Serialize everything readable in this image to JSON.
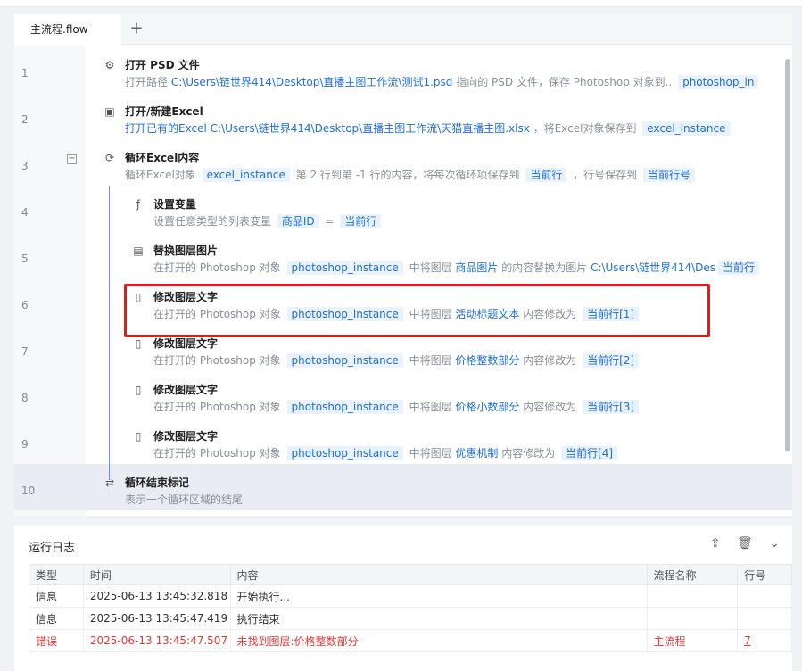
{
  "tab": {
    "label": "主流程.flow",
    "add": "+"
  },
  "steps": [
    {
      "num": "1",
      "icon": "psd",
      "title": "打开 PSD 文件",
      "desc": [
        {
          "t": "text",
          "v": "打开路径 "
        },
        {
          "t": "link",
          "v": "C:\\Users\\链世界414\\Desktop\\直播主图工作流\\测试1.psd"
        },
        {
          "t": "text",
          "v": " 指向的 PSD 文件，保存 Photoshop 对象到.. "
        },
        {
          "t": "chip",
          "v": "photoshop_in"
        }
      ]
    },
    {
      "num": "2",
      "icon": "excel",
      "title": "打开/新建Excel",
      "desc": [
        {
          "t": "link",
          "v": "打开已有的Excel"
        },
        {
          "t": "link",
          "v": "   C:\\Users\\链世界414\\Desktop\\直播主图工作流\\天猫直播主图.xlsx"
        },
        {
          "t": "text",
          "v": " ，将Excel对象保存到 "
        },
        {
          "t": "chip",
          "v": "excel_instance"
        }
      ]
    },
    {
      "num": "3",
      "icon": "loop",
      "title": "循环Excel内容",
      "desc": [
        {
          "t": "text",
          "v": "循环Excel对象 "
        },
        {
          "t": "chip",
          "v": "excel_instance"
        },
        {
          "t": "text",
          "v": " 第 2 行到第 -1 行的内容，将每次循环项保存到 "
        },
        {
          "t": "chip",
          "v": "当前行"
        },
        {
          "t": "text",
          "v": " ，行号保存到 "
        },
        {
          "t": "chip",
          "v": "当前行号"
        }
      ]
    },
    {
      "num": "4",
      "icon": "var",
      "title": "设置变量",
      "desc": [
        {
          "t": "text",
          "v": "设置任意类型的列表变量 "
        },
        {
          "t": "chip",
          "v": "商品ID"
        },
        {
          "t": "text",
          "v": " = "
        },
        {
          "t": "chip",
          "v": "当前行"
        }
      ]
    },
    {
      "num": "5",
      "icon": "img",
      "title": "替换图层图片",
      "desc": [
        {
          "t": "text",
          "v": "在打开的 Photoshop 对象 "
        },
        {
          "t": "chip",
          "v": "photoshop_instance"
        },
        {
          "t": "text",
          "v": " 中将图层 "
        },
        {
          "t": "link",
          "v": "商品图片"
        },
        {
          "t": "text",
          "v": "  的内容替换为图片 "
        },
        {
          "t": "link",
          "v": "C:\\Users\\链世界414\\Des"
        },
        {
          "t": "chip",
          "v": "当前行"
        }
      ]
    },
    {
      "num": "6",
      "icon": "text",
      "title": "修改图层文字",
      "desc": [
        {
          "t": "text",
          "v": "在打开的 Photoshop 对象 "
        },
        {
          "t": "chip",
          "v": "photoshop_instance"
        },
        {
          "t": "text",
          "v": " 中将图层 "
        },
        {
          "t": "link",
          "v": "活动标题文本"
        },
        {
          "t": "text",
          "v": "  内容修改为 "
        },
        {
          "t": "chip",
          "v": "当前行[1]"
        }
      ]
    },
    {
      "num": "7",
      "icon": "text",
      "title": "修改图层文字",
      "desc": [
        {
          "t": "text",
          "v": "在打开的 Photoshop 对象 "
        },
        {
          "t": "chip",
          "v": "photoshop_instance"
        },
        {
          "t": "text",
          "v": " 中将图层 "
        },
        {
          "t": "link",
          "v": "价格整数部分"
        },
        {
          "t": "text",
          "v": "  内容修改为 "
        },
        {
          "t": "chip",
          "v": "当前行[2]"
        }
      ]
    },
    {
      "num": "8",
      "icon": "text",
      "title": "修改图层文字",
      "desc": [
        {
          "t": "text",
          "v": "在打开的 Photoshop 对象 "
        },
        {
          "t": "chip",
          "v": "photoshop_instance"
        },
        {
          "t": "text",
          "v": " 中将图层 "
        },
        {
          "t": "link",
          "v": "价格小数部分"
        },
        {
          "t": "text",
          "v": "  内容修改为 "
        },
        {
          "t": "chip",
          "v": "当前行[3]"
        }
      ]
    },
    {
      "num": "9",
      "icon": "text",
      "title": "修改图层文字",
      "desc": [
        {
          "t": "text",
          "v": "在打开的 Photoshop 对象 "
        },
        {
          "t": "chip",
          "v": "photoshop_instance"
        },
        {
          "t": "text",
          "v": " 中将图层 "
        },
        {
          "t": "link",
          "v": "优惠机制"
        },
        {
          "t": "text",
          "v": "  内容修改为 "
        },
        {
          "t": "chip",
          "v": "当前行[4]"
        }
      ]
    },
    {
      "num": "10",
      "icon": "loopend",
      "title": "循环结束标记",
      "desc": [
        {
          "t": "text",
          "v": "表示一个循环区域的结尾"
        }
      ]
    }
  ],
  "log": {
    "title": "运行日志",
    "columns": [
      "类型",
      "时间",
      "内容",
      "流程名称",
      "行号"
    ],
    "rows": [
      {
        "type": "信息",
        "time": "2025-06-13 13:45:32.818",
        "content": "开始执行...",
        "flow": "",
        "line": ""
      },
      {
        "type": "信息",
        "time": "2025-06-13 13:45:47.419",
        "content": "执行结束",
        "flow": "",
        "line": ""
      },
      {
        "type": "错误",
        "time": "2025-06-13 13:45:47.507",
        "content": "未找到图层:价格整数部分",
        "flow": "主流程",
        "line": "7"
      }
    ]
  },
  "colors": {
    "accent": "#1e6fd9",
    "error": "#e53935",
    "highlight_box": "#e41b1b"
  }
}
